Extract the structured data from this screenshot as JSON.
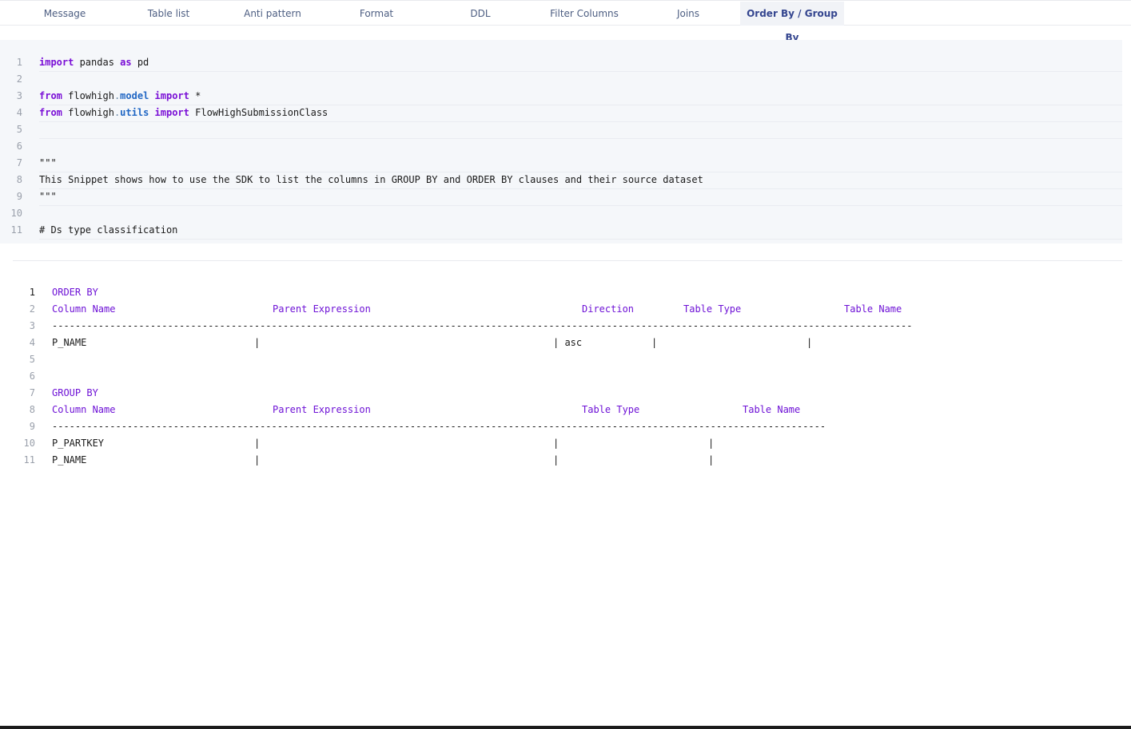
{
  "tabs": [
    {
      "label": "Message"
    },
    {
      "label": "Table list"
    },
    {
      "label": "Anti pattern"
    },
    {
      "label": "Format"
    },
    {
      "label": "DDL"
    },
    {
      "label": "Filter Columns"
    },
    {
      "label": "Joins"
    },
    {
      "label": "Order By / Group By",
      "active": true
    }
  ],
  "editor": {
    "line_numbers": [
      "1",
      "2",
      "3",
      "4",
      "5",
      "6",
      "7",
      "8",
      "9",
      "10",
      "11"
    ],
    "l1": {
      "kw1": "import",
      "t1": " pandas ",
      "kw2": "as",
      "t2": " pd"
    },
    "l3": {
      "kw1": "from",
      "t1": " flowhigh",
      "dot": ".",
      "mod": "model",
      "sp": " ",
      "kw2": "import",
      "t2": " *"
    },
    "l4": {
      "kw1": "from",
      "t1": " flowhigh",
      "dot": ".",
      "mod": "utils",
      "sp": " ",
      "kw2": "import",
      "t2": " FlowHighSubmissionClass"
    },
    "l7": "\"\"\"",
    "l8": "This Snippet shows how to use the SDK to list the columns in GROUP BY and ORDER BY clauses and their source dataset",
    "l9": "\"\"\"",
    "l11": "# Ds type classification"
  },
  "output": {
    "line_numbers": [
      "1",
      "2",
      "3",
      "4",
      "5",
      "6",
      "7",
      "8",
      "9",
      "10",
      "11"
    ],
    "order_by": {
      "title": "ORDER BY",
      "headers": [
        "Column Name",
        "Parent Expression",
        "Direction",
        "Table Type",
        "Table Name"
      ],
      "separator": "-----------------------------------------------------------------------------------------------------------------------------------------------------",
      "rows": [
        {
          "column": "P_NAME",
          "sep1": "|",
          "sep2": "| asc",
          "sep3": "|",
          "sep4": "|"
        }
      ]
    },
    "group_by": {
      "title": "GROUP BY",
      "headers": [
        "Column Name",
        "Parent Expression",
        "Table Type",
        "Table Name"
      ],
      "separator": "--------------------------------------------------------------------------------------------------------------------------------------",
      "rows": [
        {
          "column": "P_PARTKEY",
          "sep1": "|",
          "sep2": "|",
          "sep3": "|"
        },
        {
          "column": "P_NAME",
          "sep1": "|",
          "sep2": "|",
          "sep3": "|"
        }
      ]
    }
  },
  "colors": {
    "keyword": "#7a0fd6",
    "module": "#2167c4",
    "string": "#e0161c",
    "comment": "#2f9fa3",
    "header": "#6e12d6",
    "active_tab": "#34458f"
  }
}
